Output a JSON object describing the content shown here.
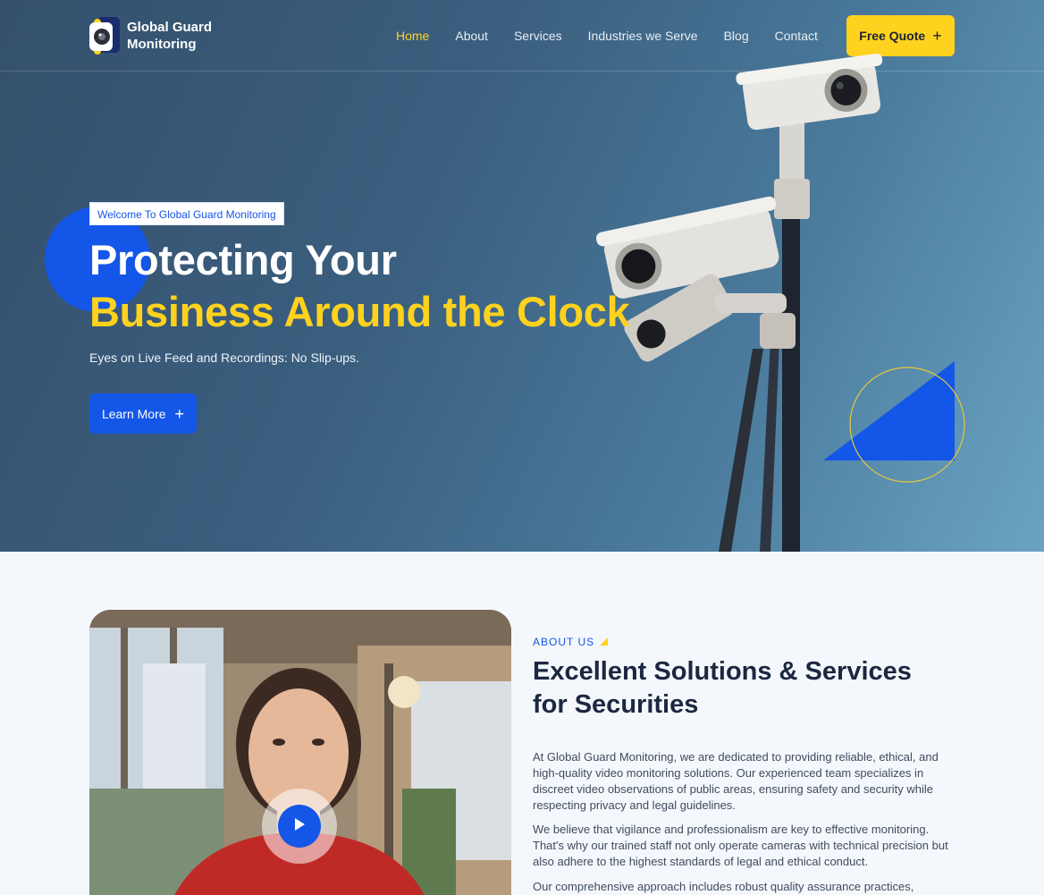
{
  "nav": {
    "logo_line1": "Global Guard",
    "logo_line2": "Monitoring",
    "links": [
      "Home",
      "About",
      "Services",
      "Industries we Serve",
      "Blog",
      "Contact"
    ],
    "quote_label": "Free Quote"
  },
  "hero": {
    "tag": "Welcome To Global Guard Monitoring",
    "title_line1": "Protecting Your",
    "title_line2": "Business Around the Clock",
    "subtitle": "Eyes on Live Feed and Recordings: No Slip-ups.",
    "button_label": "Learn More"
  },
  "about": {
    "eyebrow": "ABOUT US",
    "heading": "Excellent Solutions & Services for Securities",
    "paragraph1": "At Global Guard Monitoring, we are dedicated to providing reliable, ethical, and high-quality video monitoring solutions. Our experienced team specializes in discreet video observations of public areas, ensuring safety and security while respecting privacy and legal guidelines.",
    "paragraph2": "We believe that vigilance and professionalism are key to effective monitoring. That's why our trained staff not only operate cameras with technical precision but also adhere to the highest standards of legal and ethical conduct.",
    "paragraph3": "Our comprehensive approach includes robust quality assurance practices,"
  },
  "colors": {
    "accent_yellow": "#ffd21e",
    "accent_blue": "#1456e8",
    "heading_dark": "#1c2740"
  },
  "icons": [
    "camera-logo-icon",
    "plus-icon",
    "play-icon",
    "triangle-icon"
  ]
}
